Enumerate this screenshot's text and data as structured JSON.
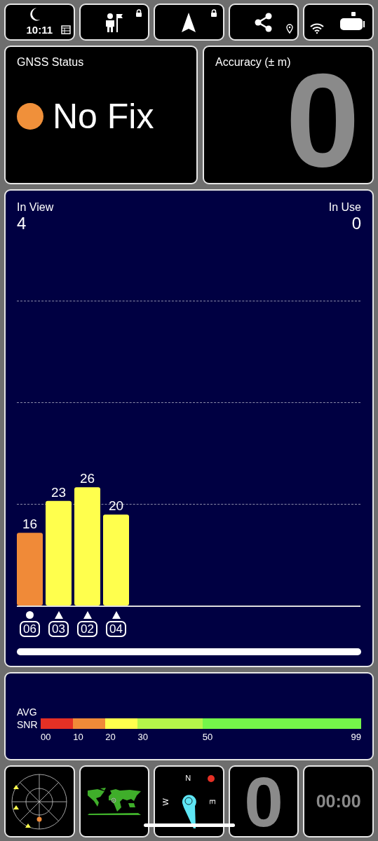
{
  "top_bar": {
    "clock": "10:11"
  },
  "gnss_status": {
    "title": "GNSS Status",
    "status": "No Fix",
    "color": "#f0903a"
  },
  "accuracy": {
    "title": "Accuracy (± m)",
    "value": "0"
  },
  "satellites": {
    "in_view_label": "In View",
    "in_view": "4",
    "in_use_label": "In Use",
    "in_use": "0",
    "chart_data": {
      "type": "bar",
      "categories": [
        "06",
        "03",
        "02",
        "04"
      ],
      "series": [
        {
          "values": [
            16,
            23,
            26,
            20
          ]
        }
      ],
      "data_labels": true
    },
    "markers": [
      {
        "kind": "circle"
      },
      {
        "kind": "triangle"
      },
      {
        "kind": "triangle"
      },
      {
        "kind": "triangle"
      }
    ]
  },
  "snr_scale": {
    "label_1": "AVG",
    "label_2": "SNR",
    "segments": [
      {
        "label": "00",
        "color": "#e53025"
      },
      {
        "label": "10",
        "color": "#f08a38"
      },
      {
        "label": "20",
        "color": "#ffff4d"
      },
      {
        "label": "30",
        "color": "#b5f54a"
      },
      {
        "label": "50",
        "color": "#74f54a"
      }
    ],
    "end_label": "99"
  },
  "compass": {
    "north": "N",
    "west": "W",
    "east": "E"
  },
  "speed": {
    "value": "0"
  },
  "timer": {
    "value": "00:00"
  }
}
